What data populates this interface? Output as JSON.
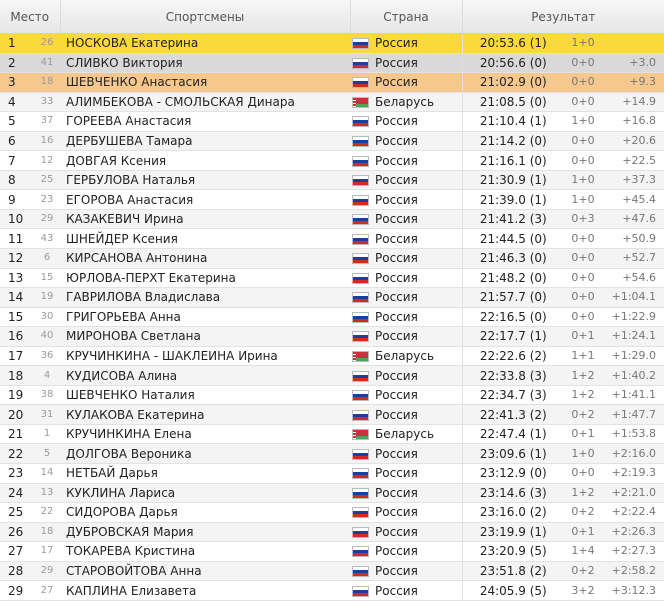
{
  "headers": {
    "place": "Место",
    "athletes": "Спортсмены",
    "country": "Страна",
    "result": "Результат"
  },
  "rows": [
    {
      "place": "1",
      "bib": "26",
      "name": "НОСКОВА Екатерина",
      "flag": "russia-flag-icon",
      "country": "Россия",
      "time": "20:53.6 (1)",
      "shooting": "1+0",
      "gap": ""
    },
    {
      "place": "2",
      "bib": "41",
      "name": "СЛИВКО Виктория",
      "flag": "russia-flag-icon",
      "country": "Россия",
      "time": "20:56.6 (0)",
      "shooting": "0+0",
      "gap": "+3.0"
    },
    {
      "place": "3",
      "bib": "18",
      "name": "ШЕВЧЕНКО Анастасия",
      "flag": "russia-flag-icon",
      "country": "Россия",
      "time": "21:02.9 (0)",
      "shooting": "0+0",
      "gap": "+9.3"
    },
    {
      "place": "4",
      "bib": "33",
      "name": "АЛИМБЕКОВА - СМОЛЬСКАЯ Динара",
      "flag": "belarus-flag-icon",
      "country": "Беларусь",
      "time": "21:08.5 (0)",
      "shooting": "0+0",
      "gap": "+14.9"
    },
    {
      "place": "5",
      "bib": "37",
      "name": "ГОРЕЕВА Анастасия",
      "flag": "russia-flag-icon",
      "country": "Россия",
      "time": "21:10.4 (1)",
      "shooting": "1+0",
      "gap": "+16.8"
    },
    {
      "place": "6",
      "bib": "16",
      "name": "ДЕРБУШЕВА Тамара",
      "flag": "russia-flag-icon",
      "country": "Россия",
      "time": "21:14.2 (0)",
      "shooting": "0+0",
      "gap": "+20.6"
    },
    {
      "place": "7",
      "bib": "12",
      "name": "ДОВГАЯ Ксения",
      "flag": "russia-flag-icon",
      "country": "Россия",
      "time": "21:16.1 (0)",
      "shooting": "0+0",
      "gap": "+22.5"
    },
    {
      "place": "8",
      "bib": "25",
      "name": "ГЕРБУЛОВА Наталья",
      "flag": "russia-flag-icon",
      "country": "Россия",
      "time": "21:30.9 (1)",
      "shooting": "1+0",
      "gap": "+37.3"
    },
    {
      "place": "9",
      "bib": "23",
      "name": "ЕГОРОВА Анастасия",
      "flag": "russia-flag-icon",
      "country": "Россия",
      "time": "21:39.0 (1)",
      "shooting": "1+0",
      "gap": "+45.4"
    },
    {
      "place": "10",
      "bib": "29",
      "name": "КАЗАКЕВИЧ Ирина",
      "flag": "russia-flag-icon",
      "country": "Россия",
      "time": "21:41.2 (3)",
      "shooting": "0+3",
      "gap": "+47.6"
    },
    {
      "place": "11",
      "bib": "43",
      "name": "ШНЕЙДЕР Ксения",
      "flag": "russia-flag-icon",
      "country": "Россия",
      "time": "21:44.5 (0)",
      "shooting": "0+0",
      "gap": "+50.9"
    },
    {
      "place": "12",
      "bib": "6",
      "name": "КИРСАНОВА Антонина",
      "flag": "russia-flag-icon",
      "country": "Россия",
      "time": "21:46.3 (0)",
      "shooting": "0+0",
      "gap": "+52.7"
    },
    {
      "place": "13",
      "bib": "15",
      "name": "ЮРЛОВА-ПЕРХТ Екатерина",
      "flag": "russia-flag-icon",
      "country": "Россия",
      "time": "21:48.2 (0)",
      "shooting": "0+0",
      "gap": "+54.6"
    },
    {
      "place": "14",
      "bib": "19",
      "name": "ГАВРИЛОВА Владислава",
      "flag": "russia-flag-icon",
      "country": "Россия",
      "time": "21:57.7 (0)",
      "shooting": "0+0",
      "gap": "+1:04.1"
    },
    {
      "place": "15",
      "bib": "30",
      "name": "ГРИГОРЬЕВА Анна",
      "flag": "russia-flag-icon",
      "country": "Россия",
      "time": "22:16.5 (0)",
      "shooting": "0+0",
      "gap": "+1:22.9"
    },
    {
      "place": "16",
      "bib": "40",
      "name": "МИРОНОВА Светлана",
      "flag": "russia-flag-icon",
      "country": "Россия",
      "time": "22:17.7 (1)",
      "shooting": "0+1",
      "gap": "+1:24.1"
    },
    {
      "place": "17",
      "bib": "36",
      "name": "КРУЧИНКИНА - ШАКЛЕИНА Ирина",
      "flag": "belarus-flag-icon",
      "country": "Беларусь",
      "time": "22:22.6 (2)",
      "shooting": "1+1",
      "gap": "+1:29.0"
    },
    {
      "place": "18",
      "bib": "4",
      "name": "КУДИСОВА Алина",
      "flag": "russia-flag-icon",
      "country": "Россия",
      "time": "22:33.8 (3)",
      "shooting": "1+2",
      "gap": "+1:40.2"
    },
    {
      "place": "19",
      "bib": "38",
      "name": "ШЕВЧЕНКО Наталия",
      "flag": "russia-flag-icon",
      "country": "Россия",
      "time": "22:34.7 (3)",
      "shooting": "1+2",
      "gap": "+1:41.1"
    },
    {
      "place": "20",
      "bib": "31",
      "name": "КУЛАКОВА Екатерина",
      "flag": "russia-flag-icon",
      "country": "Россия",
      "time": "22:41.3 (2)",
      "shooting": "0+2",
      "gap": "+1:47.7"
    },
    {
      "place": "21",
      "bib": "1",
      "name": "КРУЧИНКИНА Елена",
      "flag": "belarus-flag-icon",
      "country": "Беларусь",
      "time": "22:47.4 (1)",
      "shooting": "0+1",
      "gap": "+1:53.8"
    },
    {
      "place": "22",
      "bib": "5",
      "name": "ДОЛГОВА Вероника",
      "flag": "russia-flag-icon",
      "country": "Россия",
      "time": "23:09.6 (1)",
      "shooting": "1+0",
      "gap": "+2:16.0"
    },
    {
      "place": "23",
      "bib": "14",
      "name": "НЕТБАЙ Дарья",
      "flag": "russia-flag-icon",
      "country": "Россия",
      "time": "23:12.9 (0)",
      "shooting": "0+0",
      "gap": "+2:19.3"
    },
    {
      "place": "24",
      "bib": "13",
      "name": "КУКЛИНА Лариса",
      "flag": "russia-flag-icon",
      "country": "Россия",
      "time": "23:14.6 (3)",
      "shooting": "1+2",
      "gap": "+2:21.0"
    },
    {
      "place": "25",
      "bib": "22",
      "name": "СИДОРОВА Дарья",
      "flag": "russia-flag-icon",
      "country": "Россия",
      "time": "23:16.0 (2)",
      "shooting": "0+2",
      "gap": "+2:22.4"
    },
    {
      "place": "26",
      "bib": "18",
      "name": "ДУБРОВСКАЯ Мария",
      "flag": "russia-flag-icon",
      "country": "Россия",
      "time": "23:19.9 (1)",
      "shooting": "0+1",
      "gap": "+2:26.3"
    },
    {
      "place": "27",
      "bib": "17",
      "name": "ТОКАРЕВА Кристина",
      "flag": "russia-flag-icon",
      "country": "Россия",
      "time": "23:20.9 (5)",
      "shooting": "1+4",
      "gap": "+2:27.3"
    },
    {
      "place": "28",
      "bib": "29",
      "name": "СТАРОВОЙТОВА Анна",
      "flag": "russia-flag-icon",
      "country": "Россия",
      "time": "23:51.8 (2)",
      "shooting": "0+2",
      "gap": "+2:58.2"
    },
    {
      "place": "29",
      "bib": "27",
      "name": "КАПЛИНА Елизавета",
      "flag": "russia-flag-icon",
      "country": "Россия",
      "time": "24:05.9 (5)",
      "shooting": "3+2",
      "gap": "+3:12.3"
    }
  ]
}
